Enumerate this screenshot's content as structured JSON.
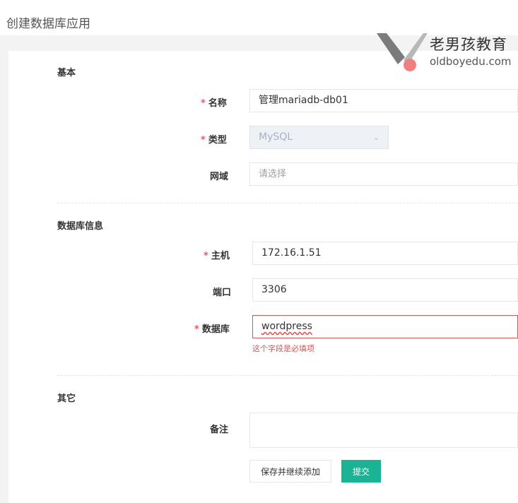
{
  "page": {
    "title": "创建数据库应用"
  },
  "logo": {
    "name_cn": "老男孩教育",
    "name_en": "oldboyedu.com"
  },
  "sections": {
    "basic": {
      "title": "基本"
    },
    "db_info": {
      "title": "数据库信息"
    },
    "other": {
      "title": "其它"
    }
  },
  "fields": {
    "name": {
      "label": "名称",
      "required_mark": "*",
      "value": "管理mariadb-db01"
    },
    "type": {
      "label": "类型",
      "required_mark": "*",
      "value": "MySQL",
      "caret": "⌄"
    },
    "domain": {
      "label": "网域",
      "placeholder": "请选择"
    },
    "host": {
      "label": "主机",
      "required_mark": "*",
      "value": "172.16.1.51"
    },
    "port": {
      "label": "端口",
      "value": "3306"
    },
    "database": {
      "label": "数据库",
      "required_mark": "*",
      "value": "wordpress",
      "error": "这个字段是必填项"
    },
    "comment": {
      "label": "备注",
      "value": ""
    }
  },
  "buttons": {
    "save_continue": "保存并继续添加",
    "submit": "提交"
  },
  "colors": {
    "primary": "#1ab394",
    "error": "#d9534f",
    "required": "#ed5565",
    "logo_dot": "#f08080"
  }
}
